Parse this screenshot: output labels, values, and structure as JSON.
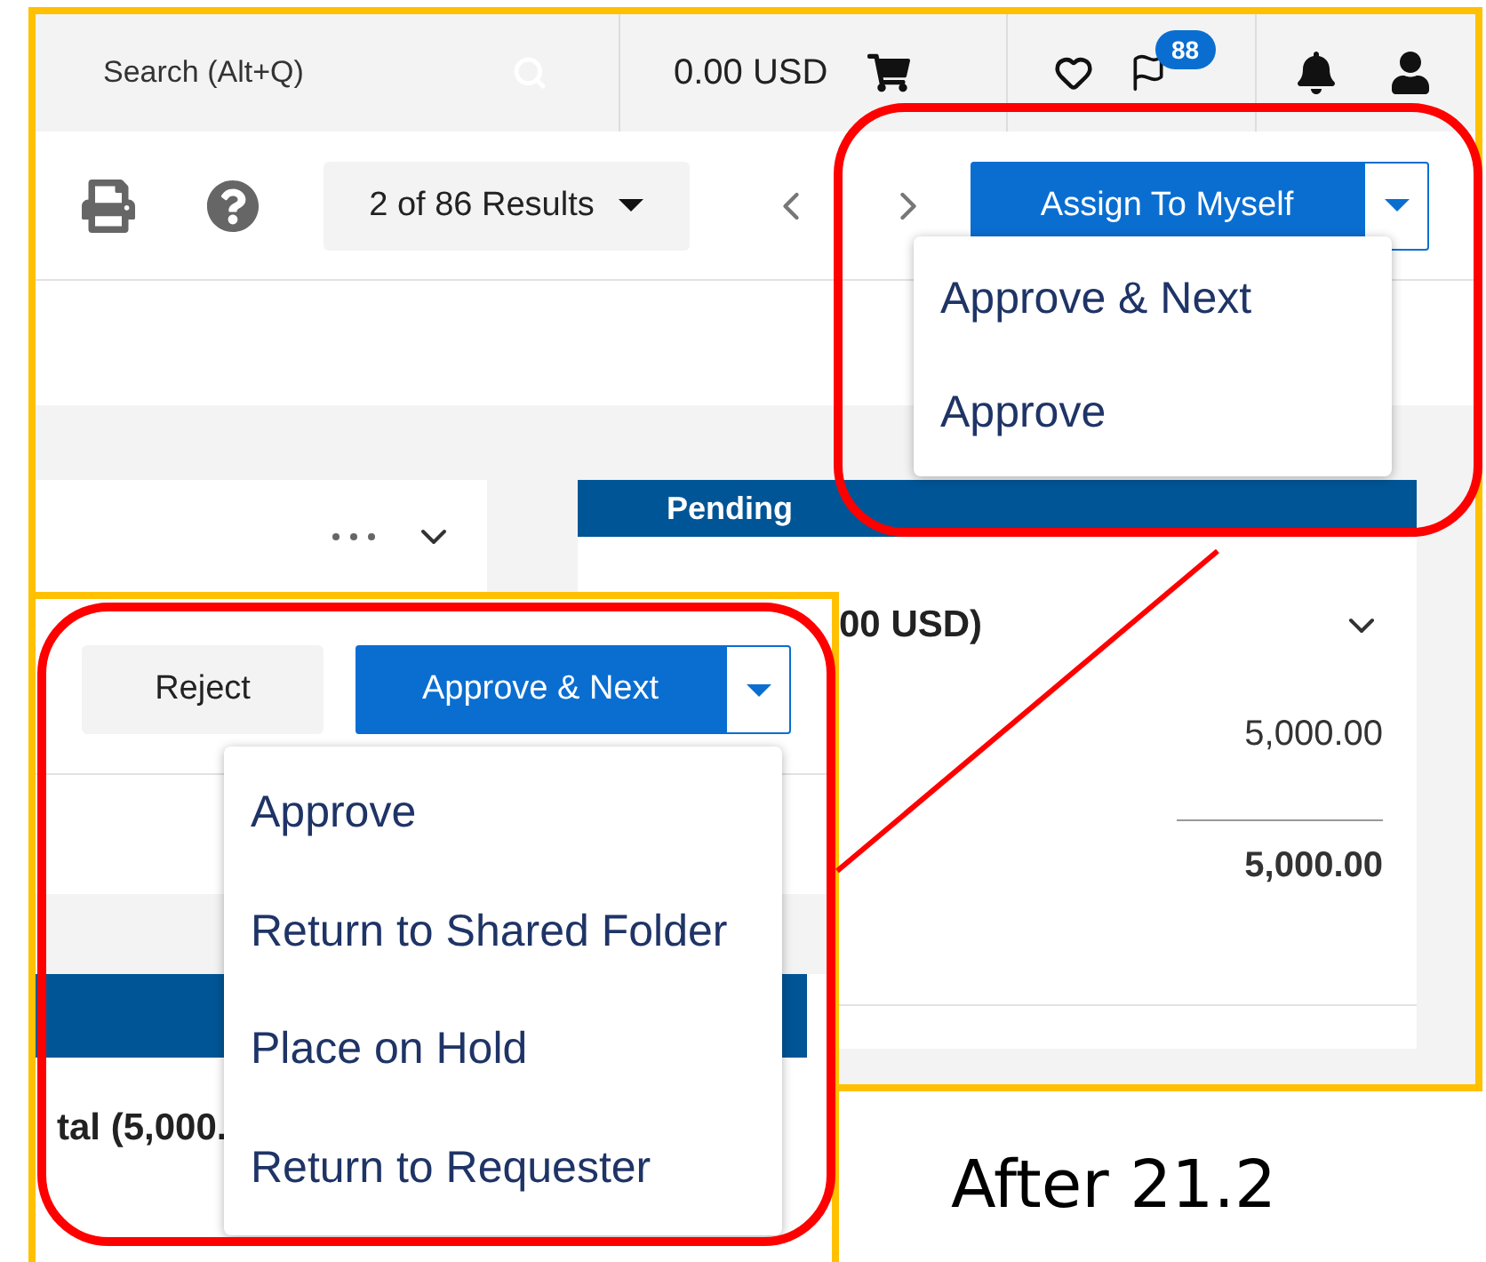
{
  "header": {
    "search": {
      "placeholder": "Search (Alt+Q)"
    },
    "cart_total": "0.00 USD",
    "notifications_badge": "88"
  },
  "toolbar": {
    "results": "2 of 86 Results",
    "assign_button": "Assign To Myself",
    "menu": {
      "expanded": true,
      "items": [
        "Approve & Next",
        "Approve"
      ]
    }
  },
  "pending_card": {
    "status": "Pending",
    "total_label": "00 USD)",
    "line_amount": "5,000.00",
    "total_amount": "5,000.00"
  },
  "after_panel": {
    "reject_button": "Reject",
    "approve_button": "Approve & Next",
    "menu": {
      "expanded": true,
      "items": [
        "Approve",
        "Return to Shared Folder",
        "Place on Hold",
        "Return to Requester"
      ]
    },
    "total_label": "tal (5,000."
  },
  "caption": "After 21.2"
}
